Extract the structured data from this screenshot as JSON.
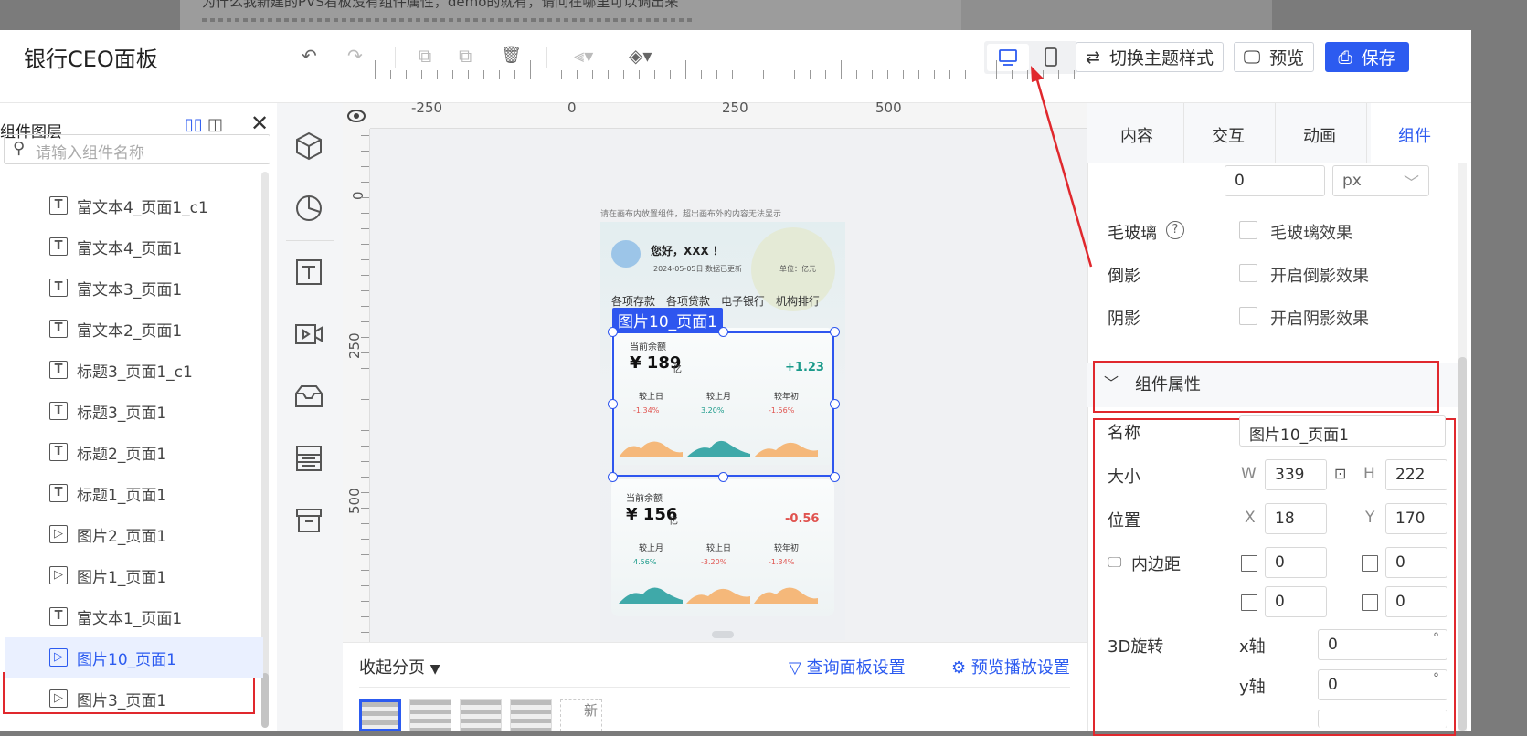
{
  "background_doc": {
    "text": "为什么我新建的PVS看板没有组件属性，demo的就有，请问在哪里可以调出来"
  },
  "header": {
    "title": "银行CEO面板",
    "buttons": {
      "theme": "切换主题样式",
      "preview": "预览",
      "save": "保存"
    }
  },
  "layers": {
    "title": "组件图层",
    "search_placeholder": "请输入组件名称",
    "items": [
      {
        "label": "富文本4_页面1_c1",
        "icon": "T"
      },
      {
        "label": "富文本4_页面1",
        "icon": "T"
      },
      {
        "label": "富文本3_页面1",
        "icon": "T"
      },
      {
        "label": "富文本2_页面1",
        "icon": "T"
      },
      {
        "label": "标题3_页面1_c1",
        "icon": "T"
      },
      {
        "label": "标题3_页面1",
        "icon": "T"
      },
      {
        "label": "标题2_页面1",
        "icon": "T"
      },
      {
        "label": "标题1_页面1",
        "icon": "T"
      },
      {
        "label": "图片2_页面1",
        "icon": "▷"
      },
      {
        "label": "图片1_页面1",
        "icon": "▷"
      },
      {
        "label": "富文本1_页面1",
        "icon": "T"
      },
      {
        "label": "图片10_页面1",
        "icon": "▷",
        "selected": true
      },
      {
        "label": "图片3_页面1",
        "icon": "▷"
      }
    ]
  },
  "ruler": {
    "top": [
      "-250",
      "0",
      "250",
      "500"
    ],
    "left": [
      "0",
      "250",
      "500"
    ]
  },
  "phone": {
    "hint": "请在画布内放置组件，超出画布外的内容无法显示",
    "greeting": "您好，XXX ！",
    "date": "2024-05-05日 数据已更新",
    "unit": "单位：亿元",
    "tabs": [
      "各项存款",
      "各项贷款",
      "电子银行",
      "机构排行"
    ],
    "card1": {
      "label": "当前余额",
      "amount": "¥ 189",
      "unit": "亿",
      "change": "+1.23",
      "stats": [
        {
          "name": "较上日",
          "value": "-1.34%"
        },
        {
          "name": "较上月",
          "value": "3.20%"
        },
        {
          "name": "较年初",
          "value": "-1.56%"
        }
      ]
    },
    "card2": {
      "label": "当前余额",
      "amount": "¥ 156",
      "unit": "亿",
      "change": "-0.56",
      "stats": [
        {
          "name": "较上月",
          "value": "4.56%"
        },
        {
          "name": "较上日",
          "value": "-3.20%"
        },
        {
          "name": "较年初",
          "value": "-1.34%"
        }
      ]
    }
  },
  "selection": {
    "label": "图片10_页面1"
  },
  "bottom": {
    "collapse": "收起分页",
    "query_settings": "查询面板设置",
    "preview_settings": "预览播放设置",
    "new_label": "新"
  },
  "right_panel": {
    "tabs": [
      "内容",
      "交互",
      "动画",
      "组件"
    ],
    "top_input": {
      "value": "0",
      "unit": "px"
    },
    "glass": {
      "label": "毛玻璃",
      "checkbox": "毛玻璃效果"
    },
    "reflection": {
      "label": "倒影",
      "checkbox": "开启倒影效果"
    },
    "shadow": {
      "label": "阴影",
      "checkbox": "开启阴影效果"
    },
    "section_title": "组件属性",
    "name": {
      "label": "名称",
      "value": "图片10_页面1"
    },
    "size": {
      "label": "大小",
      "w_label": "W",
      "w": "339",
      "h_label": "H",
      "h": "222"
    },
    "position": {
      "label": "位置",
      "x_label": "X",
      "x": "18",
      "y_label": "Y",
      "y": "170"
    },
    "padding": {
      "label": "内边距",
      "top": "0",
      "bottom": "0",
      "left": "0",
      "right": "0"
    },
    "rotate3d": {
      "label": "3D旋转",
      "x_label": "x轴",
      "x": "0",
      "y_label": "y轴",
      "y": "0",
      "unit": "°"
    }
  },
  "colors": {
    "accent": "#2c5bf0",
    "annotation": "#e0282d",
    "positive": "#1a9a8a",
    "negative": "#e0534f"
  }
}
